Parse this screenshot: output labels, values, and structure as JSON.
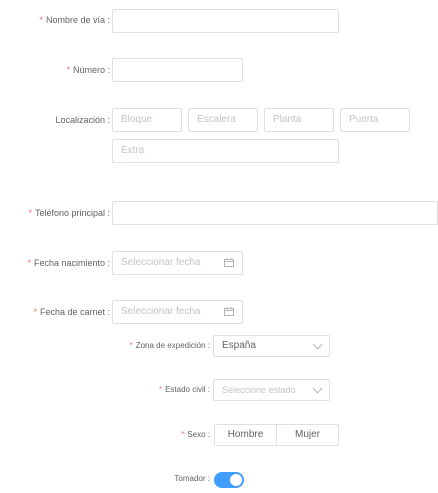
{
  "fields": {
    "street": {
      "label": "Nombre de vía :",
      "required": true,
      "value": ""
    },
    "number": {
      "label": "Número :",
      "required": true,
      "value": ""
    },
    "location": {
      "label": "Localización :",
      "placeholders": {
        "block": "Bloque",
        "stair": "Escalera",
        "floor": "Planta",
        "door": "Puerta",
        "extra": "Extra"
      }
    },
    "phone": {
      "label": "Teléfono principal :",
      "required": true,
      "value": ""
    },
    "birth_date": {
      "label": "Fecha nacimiento :",
      "required": true,
      "placeholder": "Seleccionar fecha"
    },
    "license_date": {
      "label": "Fecha de carnet :",
      "required": true,
      "placeholder": "Seleccionar fecha"
    },
    "issue_zone": {
      "label": "Zona de expedición :",
      "required": true,
      "value": "España"
    },
    "civil_status": {
      "label": "Estado civil :",
      "required": true,
      "placeholder": "Seleccione estado"
    },
    "sex": {
      "label": "Sexo :",
      "required": true,
      "options": [
        "Hombre",
        "Mujer"
      ]
    },
    "taker": {
      "label": "Tomador :",
      "enabled": true
    }
  },
  "colors": {
    "required": "#f56c6c",
    "accent": "#409eff",
    "border": "#dcdfe6"
  },
  "icons": {
    "calendar": "calendar-icon",
    "dropdown": "chevron-down-icon"
  }
}
